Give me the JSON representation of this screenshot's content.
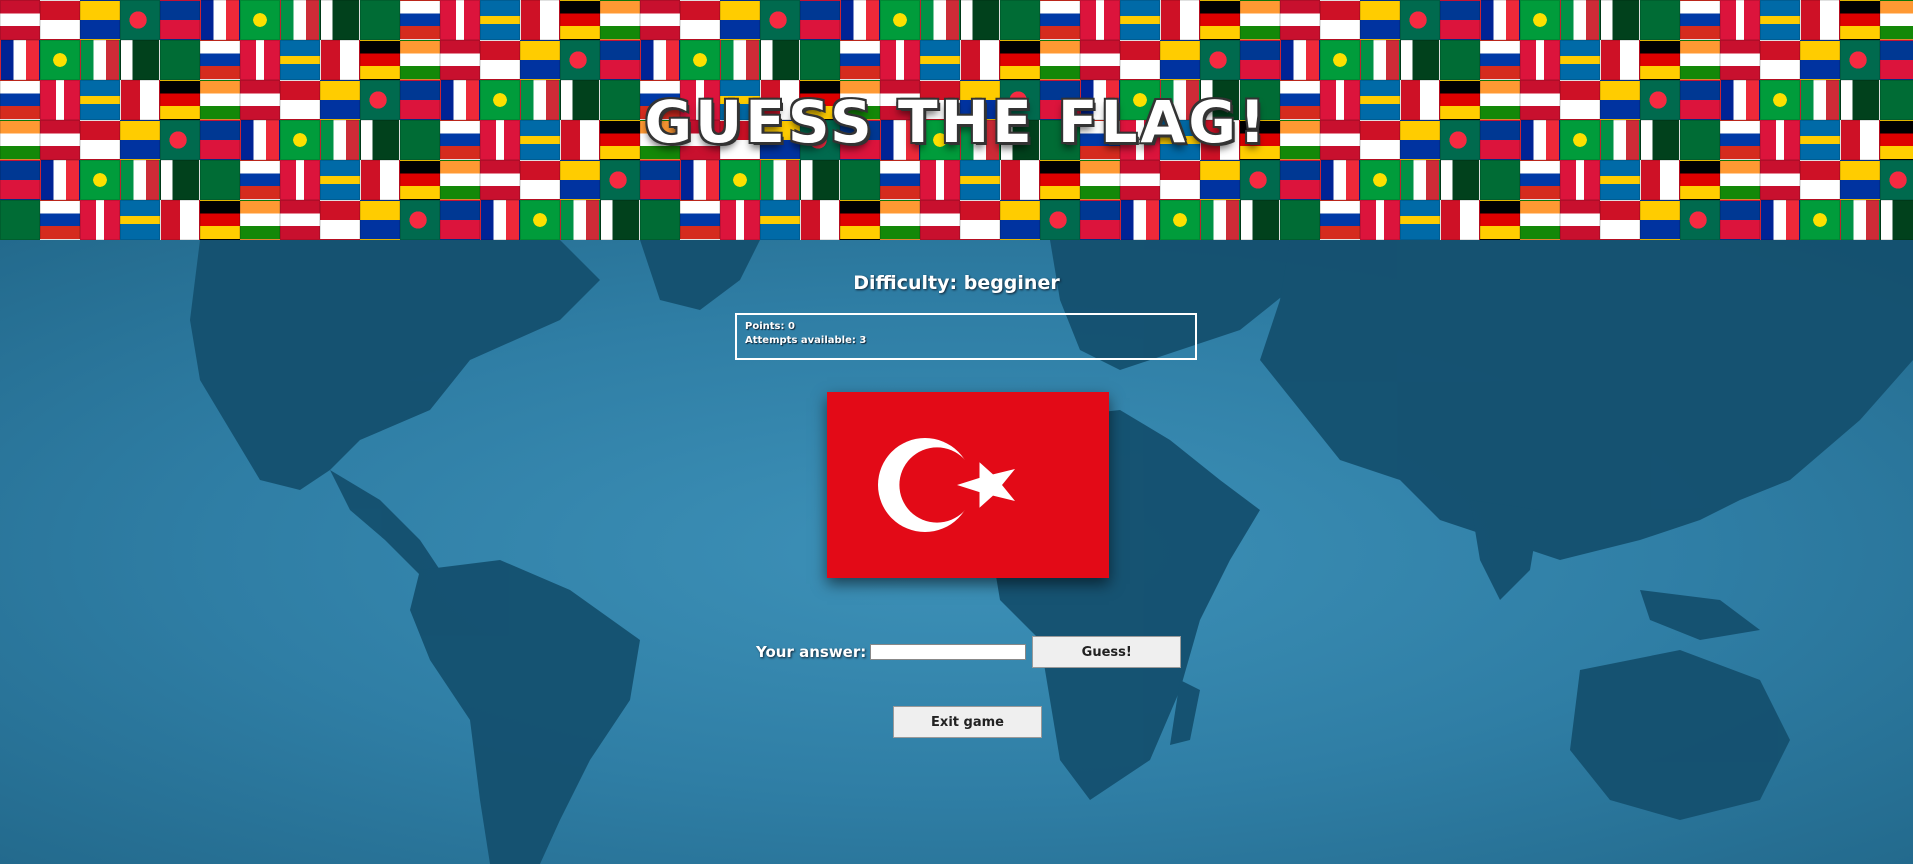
{
  "header": {
    "title": "GUESS THE FLAG!"
  },
  "game": {
    "difficulty_text": "Difficulty: begginer",
    "points_text": "Points: 0",
    "attempts_text": "Attempts available: 3",
    "current_flag_icon": "turkey-flag-icon"
  },
  "answer": {
    "label": "Your answer:",
    "value": "",
    "placeholder": "",
    "guess_label": "Guess!"
  },
  "controls": {
    "exit_label": "Exit game"
  },
  "colors": {
    "map_ocean": "#2f7ea5",
    "map_land": "#14506f",
    "flag_red": "#e30a17",
    "banner_base": "#b32222"
  }
}
